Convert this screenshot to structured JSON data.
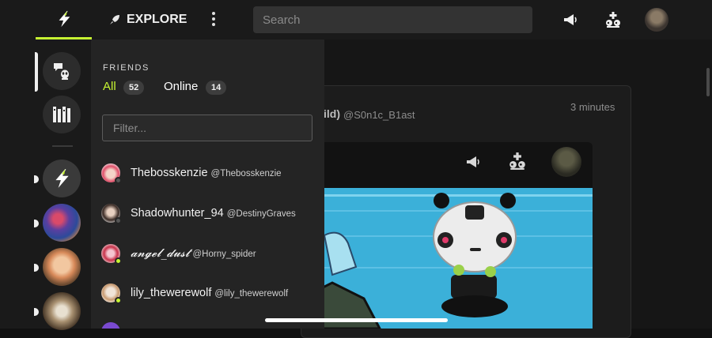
{
  "topbar": {
    "explore_label": "EXPLORE",
    "search_placeholder": "Search",
    "icons": [
      "bolt-logo-icon",
      "rocket-icon",
      "more-vertical-icon",
      "megaphone-icon",
      "friends-icon",
      "profile-avatar"
    ]
  },
  "friends": {
    "heading": "FRIENDS",
    "tab_all": "All",
    "count_all": "52",
    "tab_online": "Online",
    "count_online": "14",
    "filter_placeholder": "Filter...",
    "list": [
      {
        "name": "Thebosskenzie",
        "handle": "@Thebosskenzie",
        "status": "offline"
      },
      {
        "name": "Shadowhunter_94",
        "handle": "@DestinyGraves",
        "status": "offline"
      },
      {
        "name": "𝓪𝓷𝓰𝓮𝓵_𝓭𝓾𝓼𝓽",
        "handle": "@Horny_spider",
        "status": "online"
      },
      {
        "name": "lily_thewerewolf",
        "handle": "@lily_thewerewolf",
        "status": "online"
      }
    ]
  },
  "post": {
    "title_fragment": "ild)",
    "handle": "@S0n1c_B1ast",
    "time": "3 minutes"
  },
  "colors": {
    "accent": "#c6f432",
    "online": "#c6f432",
    "offline": "#555555",
    "panel": "#242424"
  }
}
